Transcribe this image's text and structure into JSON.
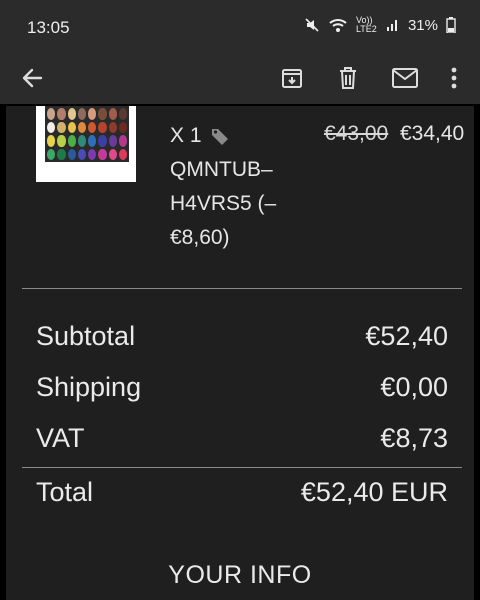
{
  "status": {
    "time": "13:05",
    "network_label": "Vo)) LTE2",
    "battery": "31%"
  },
  "colors": {
    "bar": "#2b2b2b",
    "card": "#1f1f1f",
    "text": "#eaeaea"
  },
  "order": {
    "quantity": "X 1",
    "discount_code": "QMNTUB–",
    "discount_code_2": "H4VRS5 (–",
    "discount_amount": "€8,60)",
    "price_old": "€43,00",
    "price_new": "€34,40"
  },
  "totals": {
    "subtotal_label": "Subtotal",
    "subtotal_value": "€52,40",
    "shipping_label": "Shipping",
    "shipping_value": "€0,00",
    "vat_label": "VAT",
    "vat_value": "€8,73",
    "total_label": "Total",
    "total_value": "€52,40 EUR"
  },
  "your_info_title": "YOUR INFO",
  "icons": [
    "back-arrow-icon",
    "archive-icon",
    "delete-icon",
    "mail-icon",
    "more-vert-icon",
    "tag-icon"
  ]
}
